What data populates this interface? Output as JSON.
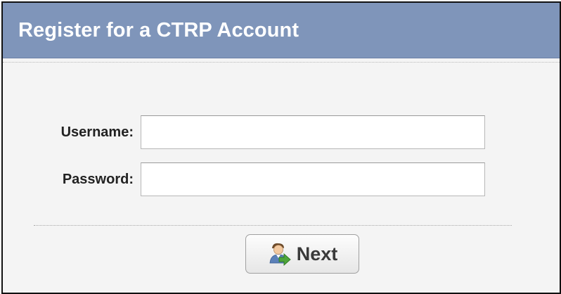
{
  "panel": {
    "title": "Register for a CTRP Account"
  },
  "form": {
    "username": {
      "label": "Username:",
      "value": "",
      "placeholder": ""
    },
    "password": {
      "label": "Password:",
      "value": "",
      "placeholder": ""
    }
  },
  "actions": {
    "next_label": "Next",
    "next_icon": "user-arrow-icon"
  },
  "colors": {
    "header_bg": "#7f95ba",
    "panel_bg": "#f4f4f4",
    "border": "#111111"
  }
}
